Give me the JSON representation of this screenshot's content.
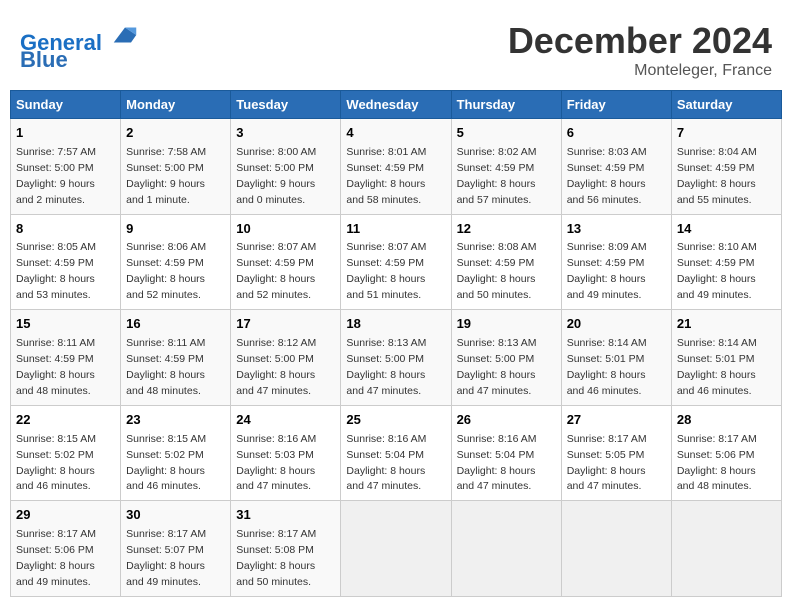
{
  "header": {
    "logo_line1": "General",
    "logo_line2": "Blue",
    "month": "December 2024",
    "location": "Monteleger, France"
  },
  "weekdays": [
    "Sunday",
    "Monday",
    "Tuesday",
    "Wednesday",
    "Thursday",
    "Friday",
    "Saturday"
  ],
  "weeks": [
    [
      {
        "day": "1",
        "sunrise": "7:57 AM",
        "sunset": "5:00 PM",
        "daylight": "9 hours and 2 minutes."
      },
      {
        "day": "2",
        "sunrise": "7:58 AM",
        "sunset": "5:00 PM",
        "daylight": "9 hours and 1 minute."
      },
      {
        "day": "3",
        "sunrise": "8:00 AM",
        "sunset": "5:00 PM",
        "daylight": "9 hours and 0 minutes."
      },
      {
        "day": "4",
        "sunrise": "8:01 AM",
        "sunset": "4:59 PM",
        "daylight": "8 hours and 58 minutes."
      },
      {
        "day": "5",
        "sunrise": "8:02 AM",
        "sunset": "4:59 PM",
        "daylight": "8 hours and 57 minutes."
      },
      {
        "day": "6",
        "sunrise": "8:03 AM",
        "sunset": "4:59 PM",
        "daylight": "8 hours and 56 minutes."
      },
      {
        "day": "7",
        "sunrise": "8:04 AM",
        "sunset": "4:59 PM",
        "daylight": "8 hours and 55 minutes."
      }
    ],
    [
      {
        "day": "8",
        "sunrise": "8:05 AM",
        "sunset": "4:59 PM",
        "daylight": "8 hours and 53 minutes."
      },
      {
        "day": "9",
        "sunrise": "8:06 AM",
        "sunset": "4:59 PM",
        "daylight": "8 hours and 52 minutes."
      },
      {
        "day": "10",
        "sunrise": "8:07 AM",
        "sunset": "4:59 PM",
        "daylight": "8 hours and 52 minutes."
      },
      {
        "day": "11",
        "sunrise": "8:07 AM",
        "sunset": "4:59 PM",
        "daylight": "8 hours and 51 minutes."
      },
      {
        "day": "12",
        "sunrise": "8:08 AM",
        "sunset": "4:59 PM",
        "daylight": "8 hours and 50 minutes."
      },
      {
        "day": "13",
        "sunrise": "8:09 AM",
        "sunset": "4:59 PM",
        "daylight": "8 hours and 49 minutes."
      },
      {
        "day": "14",
        "sunrise": "8:10 AM",
        "sunset": "4:59 PM",
        "daylight": "8 hours and 49 minutes."
      }
    ],
    [
      {
        "day": "15",
        "sunrise": "8:11 AM",
        "sunset": "4:59 PM",
        "daylight": "8 hours and 48 minutes."
      },
      {
        "day": "16",
        "sunrise": "8:11 AM",
        "sunset": "4:59 PM",
        "daylight": "8 hours and 48 minutes."
      },
      {
        "day": "17",
        "sunrise": "8:12 AM",
        "sunset": "5:00 PM",
        "daylight": "8 hours and 47 minutes."
      },
      {
        "day": "18",
        "sunrise": "8:13 AM",
        "sunset": "5:00 PM",
        "daylight": "8 hours and 47 minutes."
      },
      {
        "day": "19",
        "sunrise": "8:13 AM",
        "sunset": "5:00 PM",
        "daylight": "8 hours and 47 minutes."
      },
      {
        "day": "20",
        "sunrise": "8:14 AM",
        "sunset": "5:01 PM",
        "daylight": "8 hours and 46 minutes."
      },
      {
        "day": "21",
        "sunrise": "8:14 AM",
        "sunset": "5:01 PM",
        "daylight": "8 hours and 46 minutes."
      }
    ],
    [
      {
        "day": "22",
        "sunrise": "8:15 AM",
        "sunset": "5:02 PM",
        "daylight": "8 hours and 46 minutes."
      },
      {
        "day": "23",
        "sunrise": "8:15 AM",
        "sunset": "5:02 PM",
        "daylight": "8 hours and 46 minutes."
      },
      {
        "day": "24",
        "sunrise": "8:16 AM",
        "sunset": "5:03 PM",
        "daylight": "8 hours and 47 minutes."
      },
      {
        "day": "25",
        "sunrise": "8:16 AM",
        "sunset": "5:04 PM",
        "daylight": "8 hours and 47 minutes."
      },
      {
        "day": "26",
        "sunrise": "8:16 AM",
        "sunset": "5:04 PM",
        "daylight": "8 hours and 47 minutes."
      },
      {
        "day": "27",
        "sunrise": "8:17 AM",
        "sunset": "5:05 PM",
        "daylight": "8 hours and 47 minutes."
      },
      {
        "day": "28",
        "sunrise": "8:17 AM",
        "sunset": "5:06 PM",
        "daylight": "8 hours and 48 minutes."
      }
    ],
    [
      {
        "day": "29",
        "sunrise": "8:17 AM",
        "sunset": "5:06 PM",
        "daylight": "8 hours and 49 minutes."
      },
      {
        "day": "30",
        "sunrise": "8:17 AM",
        "sunset": "5:07 PM",
        "daylight": "8 hours and 49 minutes."
      },
      {
        "day": "31",
        "sunrise": "8:17 AM",
        "sunset": "5:08 PM",
        "daylight": "8 hours and 50 minutes."
      },
      null,
      null,
      null,
      null
    ]
  ]
}
